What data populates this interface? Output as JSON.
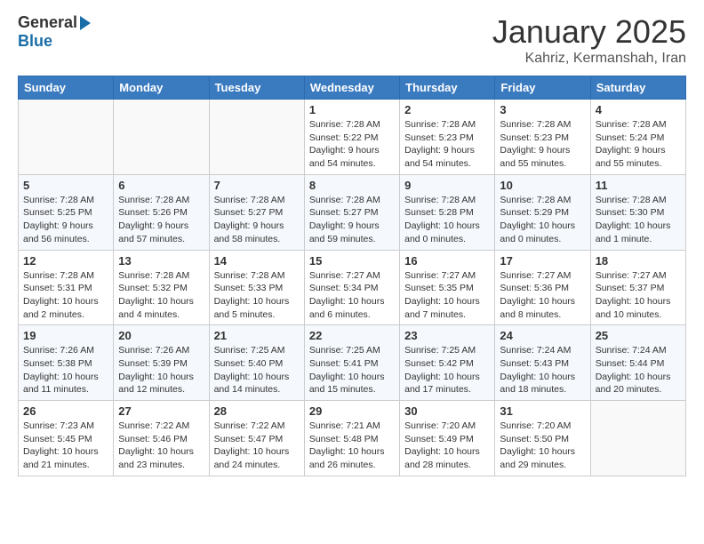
{
  "logo": {
    "general": "General",
    "blue": "Blue"
  },
  "title": "January 2025",
  "location": "Kahriz, Kermanshah, Iran",
  "days_of_week": [
    "Sunday",
    "Monday",
    "Tuesday",
    "Wednesday",
    "Thursday",
    "Friday",
    "Saturday"
  ],
  "weeks": [
    [
      {
        "day": "",
        "sunrise": "",
        "sunset": "",
        "daylight": ""
      },
      {
        "day": "",
        "sunrise": "",
        "sunset": "",
        "daylight": ""
      },
      {
        "day": "",
        "sunrise": "",
        "sunset": "",
        "daylight": ""
      },
      {
        "day": "1",
        "sunrise": "Sunrise: 7:28 AM",
        "sunset": "Sunset: 5:22 PM",
        "daylight": "Daylight: 9 hours and 54 minutes."
      },
      {
        "day": "2",
        "sunrise": "Sunrise: 7:28 AM",
        "sunset": "Sunset: 5:23 PM",
        "daylight": "Daylight: 9 hours and 54 minutes."
      },
      {
        "day": "3",
        "sunrise": "Sunrise: 7:28 AM",
        "sunset": "Sunset: 5:23 PM",
        "daylight": "Daylight: 9 hours and 55 minutes."
      },
      {
        "day": "4",
        "sunrise": "Sunrise: 7:28 AM",
        "sunset": "Sunset: 5:24 PM",
        "daylight": "Daylight: 9 hours and 55 minutes."
      }
    ],
    [
      {
        "day": "5",
        "sunrise": "Sunrise: 7:28 AM",
        "sunset": "Sunset: 5:25 PM",
        "daylight": "Daylight: 9 hours and 56 minutes."
      },
      {
        "day": "6",
        "sunrise": "Sunrise: 7:28 AM",
        "sunset": "Sunset: 5:26 PM",
        "daylight": "Daylight: 9 hours and 57 minutes."
      },
      {
        "day": "7",
        "sunrise": "Sunrise: 7:28 AM",
        "sunset": "Sunset: 5:27 PM",
        "daylight": "Daylight: 9 hours and 58 minutes."
      },
      {
        "day": "8",
        "sunrise": "Sunrise: 7:28 AM",
        "sunset": "Sunset: 5:27 PM",
        "daylight": "Daylight: 9 hours and 59 minutes."
      },
      {
        "day": "9",
        "sunrise": "Sunrise: 7:28 AM",
        "sunset": "Sunset: 5:28 PM",
        "daylight": "Daylight: 10 hours and 0 minutes."
      },
      {
        "day": "10",
        "sunrise": "Sunrise: 7:28 AM",
        "sunset": "Sunset: 5:29 PM",
        "daylight": "Daylight: 10 hours and 0 minutes."
      },
      {
        "day": "11",
        "sunrise": "Sunrise: 7:28 AM",
        "sunset": "Sunset: 5:30 PM",
        "daylight": "Daylight: 10 hours and 1 minute."
      }
    ],
    [
      {
        "day": "12",
        "sunrise": "Sunrise: 7:28 AM",
        "sunset": "Sunset: 5:31 PM",
        "daylight": "Daylight: 10 hours and 2 minutes."
      },
      {
        "day": "13",
        "sunrise": "Sunrise: 7:28 AM",
        "sunset": "Sunset: 5:32 PM",
        "daylight": "Daylight: 10 hours and 4 minutes."
      },
      {
        "day": "14",
        "sunrise": "Sunrise: 7:28 AM",
        "sunset": "Sunset: 5:33 PM",
        "daylight": "Daylight: 10 hours and 5 minutes."
      },
      {
        "day": "15",
        "sunrise": "Sunrise: 7:27 AM",
        "sunset": "Sunset: 5:34 PM",
        "daylight": "Daylight: 10 hours and 6 minutes."
      },
      {
        "day": "16",
        "sunrise": "Sunrise: 7:27 AM",
        "sunset": "Sunset: 5:35 PM",
        "daylight": "Daylight: 10 hours and 7 minutes."
      },
      {
        "day": "17",
        "sunrise": "Sunrise: 7:27 AM",
        "sunset": "Sunset: 5:36 PM",
        "daylight": "Daylight: 10 hours and 8 minutes."
      },
      {
        "day": "18",
        "sunrise": "Sunrise: 7:27 AM",
        "sunset": "Sunset: 5:37 PM",
        "daylight": "Daylight: 10 hours and 10 minutes."
      }
    ],
    [
      {
        "day": "19",
        "sunrise": "Sunrise: 7:26 AM",
        "sunset": "Sunset: 5:38 PM",
        "daylight": "Daylight: 10 hours and 11 minutes."
      },
      {
        "day": "20",
        "sunrise": "Sunrise: 7:26 AM",
        "sunset": "Sunset: 5:39 PM",
        "daylight": "Daylight: 10 hours and 12 minutes."
      },
      {
        "day": "21",
        "sunrise": "Sunrise: 7:25 AM",
        "sunset": "Sunset: 5:40 PM",
        "daylight": "Daylight: 10 hours and 14 minutes."
      },
      {
        "day": "22",
        "sunrise": "Sunrise: 7:25 AM",
        "sunset": "Sunset: 5:41 PM",
        "daylight": "Daylight: 10 hours and 15 minutes."
      },
      {
        "day": "23",
        "sunrise": "Sunrise: 7:25 AM",
        "sunset": "Sunset: 5:42 PM",
        "daylight": "Daylight: 10 hours and 17 minutes."
      },
      {
        "day": "24",
        "sunrise": "Sunrise: 7:24 AM",
        "sunset": "Sunset: 5:43 PM",
        "daylight": "Daylight: 10 hours and 18 minutes."
      },
      {
        "day": "25",
        "sunrise": "Sunrise: 7:24 AM",
        "sunset": "Sunset: 5:44 PM",
        "daylight": "Daylight: 10 hours and 20 minutes."
      }
    ],
    [
      {
        "day": "26",
        "sunrise": "Sunrise: 7:23 AM",
        "sunset": "Sunset: 5:45 PM",
        "daylight": "Daylight: 10 hours and 21 minutes."
      },
      {
        "day": "27",
        "sunrise": "Sunrise: 7:22 AM",
        "sunset": "Sunset: 5:46 PM",
        "daylight": "Daylight: 10 hours and 23 minutes."
      },
      {
        "day": "28",
        "sunrise": "Sunrise: 7:22 AM",
        "sunset": "Sunset: 5:47 PM",
        "daylight": "Daylight: 10 hours and 24 minutes."
      },
      {
        "day": "29",
        "sunrise": "Sunrise: 7:21 AM",
        "sunset": "Sunset: 5:48 PM",
        "daylight": "Daylight: 10 hours and 26 minutes."
      },
      {
        "day": "30",
        "sunrise": "Sunrise: 7:20 AM",
        "sunset": "Sunset: 5:49 PM",
        "daylight": "Daylight: 10 hours and 28 minutes."
      },
      {
        "day": "31",
        "sunrise": "Sunrise: 7:20 AM",
        "sunset": "Sunset: 5:50 PM",
        "daylight": "Daylight: 10 hours and 29 minutes."
      },
      {
        "day": "",
        "sunrise": "",
        "sunset": "",
        "daylight": ""
      }
    ]
  ]
}
